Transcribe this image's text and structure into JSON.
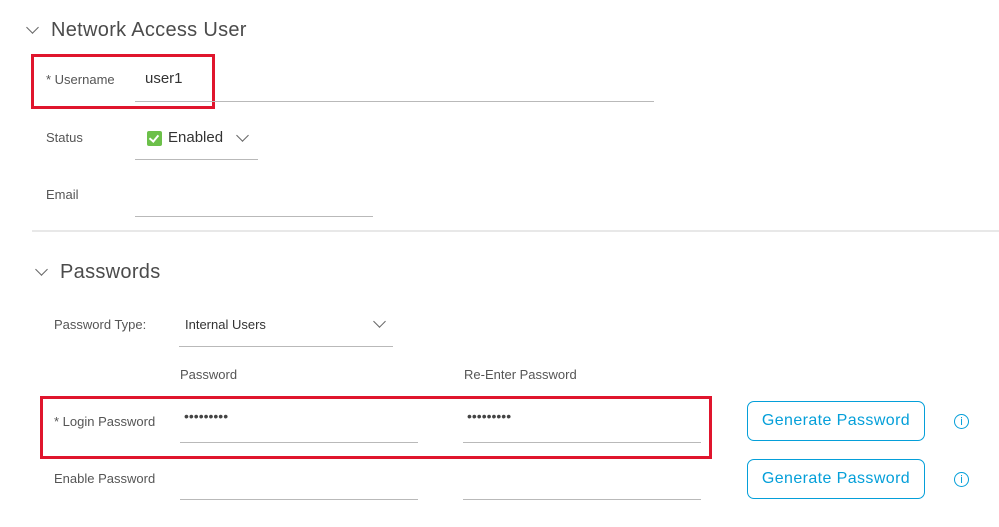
{
  "sections": {
    "network_access_user": {
      "title": "Network Access User",
      "username": {
        "label": "* Username",
        "value": "user1"
      },
      "status": {
        "label": "Status",
        "value": "Enabled"
      },
      "email": {
        "label": "Email",
        "value": ""
      }
    },
    "passwords": {
      "title": "Passwords",
      "password_type": {
        "label": "Password Type:",
        "value": "Internal Users"
      },
      "columns": {
        "password": "Password",
        "reenter": "Re-Enter Password"
      },
      "login_password": {
        "label": "* Login Password",
        "password": "•••••••••",
        "reenter": "•••••••••",
        "generate_label": "Generate Password"
      },
      "enable_password": {
        "label": "Enable Password",
        "password": "",
        "reenter": "",
        "generate_label": "Generate Password"
      }
    }
  },
  "icons": {
    "info": "i"
  },
  "colors": {
    "accent": "#049fd9",
    "highlight": "#e0152d",
    "enabled": "#6cc04a"
  }
}
